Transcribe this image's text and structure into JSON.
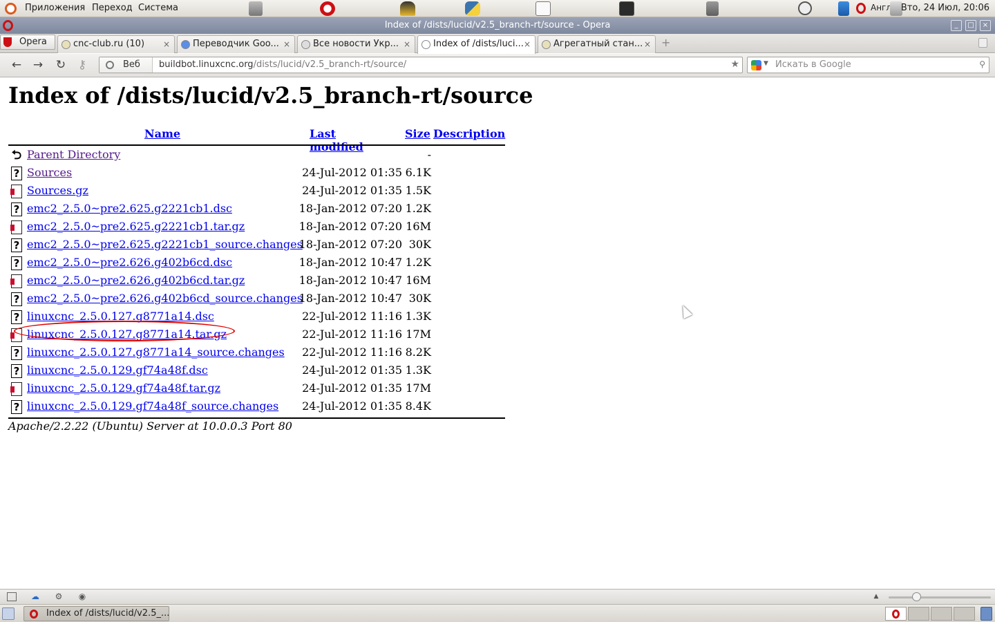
{
  "top_panel": {
    "menus": [
      "Приложения",
      "Переход",
      "Система"
    ],
    "keyboard_layout": "Англ",
    "clock": "Вто, 24 Июл, 20:06"
  },
  "window": {
    "title": "Index of /dists/lucid/v2.5_branch-rt/source - Opera"
  },
  "tabs": {
    "opera_menu_label": "Opera",
    "items": [
      {
        "label": "cnc-club.ru (10)",
        "active": false
      },
      {
        "label": "Переводчик Goo...",
        "active": false
      },
      {
        "label": "Все новости Укр...",
        "active": false
      },
      {
        "label": "Index of /dists/luci...",
        "active": true
      },
      {
        "label": "Агрегатный стан...",
        "active": false
      }
    ],
    "close_glyph": "×"
  },
  "navbar": {
    "site_label": "Веб",
    "url_host": "buildbot.linuxcnc.org",
    "url_path": "/dists/lucid/v2.5_branch-rt/source/",
    "search_placeholder": "Искать в Google"
  },
  "page": {
    "title": "Index of /dists/lucid/v2.5_branch-rt/source",
    "columns": {
      "name": "Name",
      "modified": "Last modified",
      "size": "Size",
      "description": "Description"
    },
    "rows": [
      {
        "icon": "back",
        "name": "Parent Directory",
        "modified": "",
        "size": "-",
        "visited": true
      },
      {
        "icon": "unknown",
        "name": "Sources",
        "modified": "24-Jul-2012 01:35",
        "size": "6.1K",
        "visited": true
      },
      {
        "icon": "archive",
        "name": "Sources.gz",
        "modified": "24-Jul-2012 01:35",
        "size": "1.5K",
        "visited": false
      },
      {
        "icon": "unknown",
        "name": "emc2_2.5.0~pre2.625.g2221cb1.dsc",
        "modified": "18-Jan-2012 07:20",
        "size": "1.2K",
        "visited": false
      },
      {
        "icon": "archive",
        "name": "emc2_2.5.0~pre2.625.g2221cb1.tar.gz",
        "modified": "18-Jan-2012 07:20",
        "size": "16M",
        "visited": false
      },
      {
        "icon": "unknown",
        "name": "emc2_2.5.0~pre2.625.g2221cb1_source.changes",
        "modified": "18-Jan-2012 07:20",
        "size": "30K",
        "visited": false
      },
      {
        "icon": "unknown",
        "name": "emc2_2.5.0~pre2.626.g402b6cd.dsc",
        "modified": "18-Jan-2012 10:47",
        "size": "1.2K",
        "visited": false
      },
      {
        "icon": "archive",
        "name": "emc2_2.5.0~pre2.626.g402b6cd.tar.gz",
        "modified": "18-Jan-2012 10:47",
        "size": "16M",
        "visited": false
      },
      {
        "icon": "unknown",
        "name": "emc2_2.5.0~pre2.626.g402b6cd_source.changes",
        "modified": "18-Jan-2012 10:47",
        "size": "30K",
        "visited": false
      },
      {
        "icon": "unknown",
        "name": "linuxcnc_2.5.0.127.g8771a14.dsc",
        "modified": "22-Jul-2012 11:16",
        "size": "1.3K",
        "visited": false
      },
      {
        "icon": "archive",
        "name": "linuxcnc_2.5.0.127.g8771a14.tar.gz",
        "modified": "22-Jul-2012 11:16",
        "size": "17M",
        "visited": false,
        "circled": true
      },
      {
        "icon": "unknown",
        "name": "linuxcnc_2.5.0.127.g8771a14_source.changes",
        "modified": "22-Jul-2012 11:16",
        "size": "8.2K",
        "visited": false
      },
      {
        "icon": "unknown",
        "name": "linuxcnc_2.5.0.129.gf74a48f.dsc",
        "modified": "24-Jul-2012 01:35",
        "size": "1.3K",
        "visited": false
      },
      {
        "icon": "archive",
        "name": "linuxcnc_2.5.0.129.gf74a48f.tar.gz",
        "modified": "24-Jul-2012 01:35",
        "size": "17M",
        "visited": false
      },
      {
        "icon": "unknown",
        "name": "linuxcnc_2.5.0.129.gf74a48f_source.changes",
        "modified": "24-Jul-2012 01:35",
        "size": "8.4K",
        "visited": false
      }
    ],
    "server_signature": "Apache/2.2.22 (Ubuntu) Server at 10.0.0.3 Port 80"
  },
  "taskbar": {
    "task_label": "Index of /dists/lucid/v2.5_..."
  },
  "colors": {
    "link": "#0000ee",
    "visited_link": "#551a8b",
    "annotation_circle": "#e00000",
    "opera_red": "#cc1014",
    "titlebar": "#8a93a8"
  },
  "icons": {
    "unknown_file": "?",
    "parent_dir": "⮌"
  }
}
